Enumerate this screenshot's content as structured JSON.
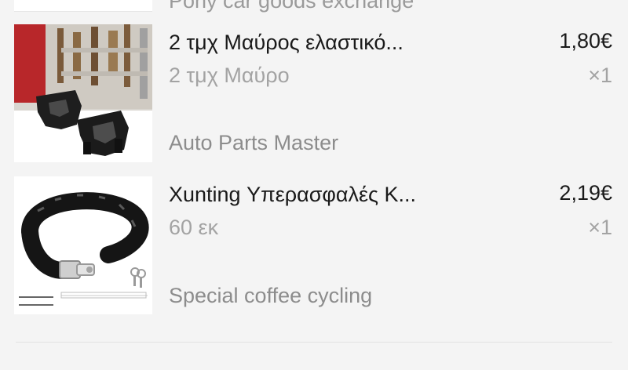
{
  "cart": {
    "previous_seller": "Pony car goods exchange",
    "items": [
      {
        "title": "2 τμχ Μαύρος ελαστικό...",
        "variant": "2 τμχ Μαύρο",
        "price": "1,80€",
        "quantity": "×1",
        "image_icon": "rubber-clamp-product-image"
      },
      {
        "title": "Xunting Υπερασφαλές Κ...",
        "variant": "60 εκ",
        "price": "2,19€",
        "quantity": "×1",
        "image_icon": "chain-lock-product-image"
      }
    ],
    "sellers": [
      {
        "name": "Auto Parts Master"
      },
      {
        "name": "Special coffee cycling"
      }
    ]
  },
  "colors": {
    "background": "#f4f4f4",
    "text_primary": "#1a1a1a",
    "text_secondary": "#a3a3a3"
  }
}
